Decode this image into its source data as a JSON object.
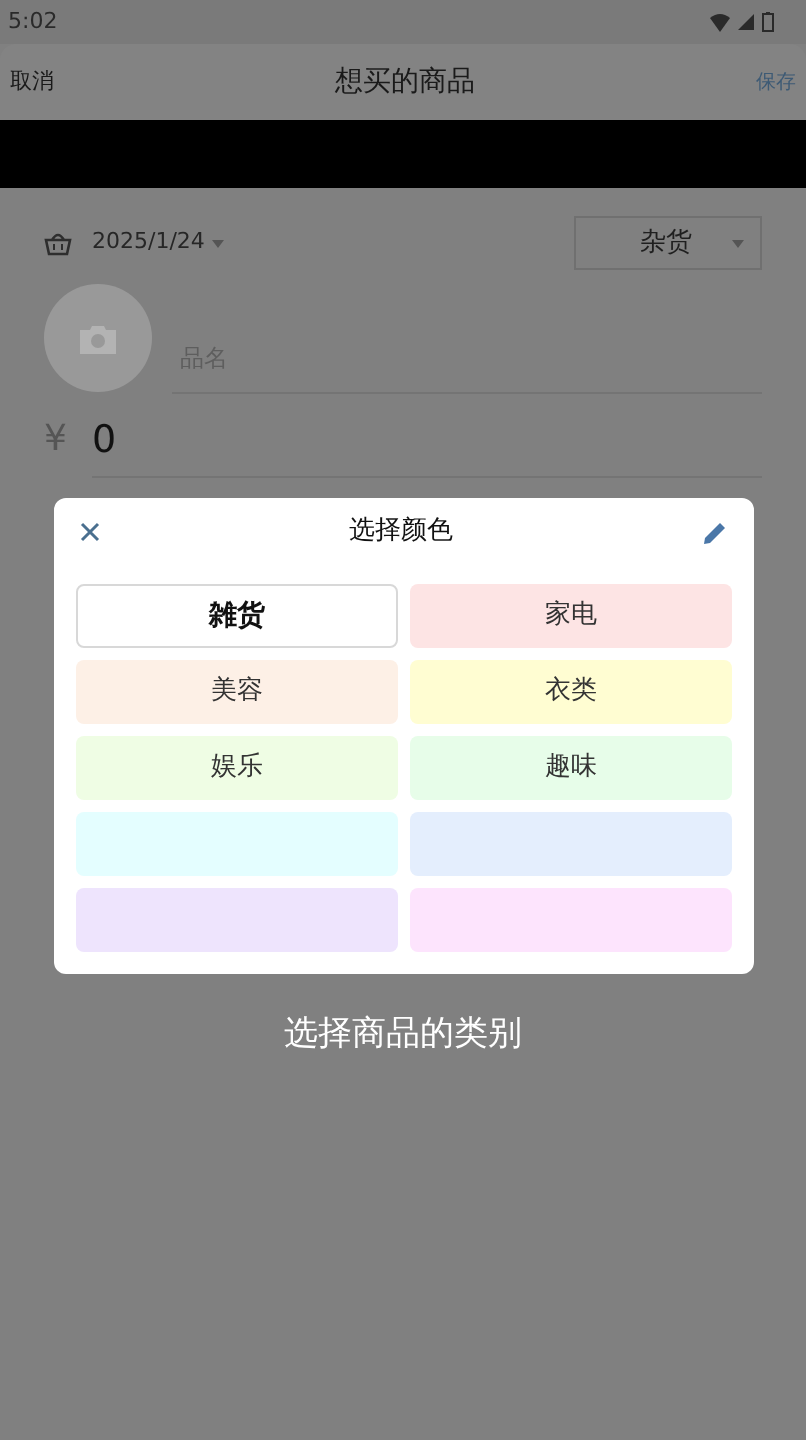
{
  "status_bar": {
    "time": "5:02"
  },
  "header": {
    "cancel": "取消",
    "title": "想买的商品",
    "save": "保存"
  },
  "form": {
    "date": "2025/1/24",
    "category": "杂货",
    "name_placeholder": "品名",
    "currency": "¥",
    "price": "0"
  },
  "dialog": {
    "title": "选择颜色",
    "swatches": [
      {
        "label": "雑货",
        "color": "#ffffff",
        "selected": true
      },
      {
        "label": "家电",
        "color": "#fde4e4",
        "selected": false
      },
      {
        "label": "美容",
        "color": "#fdf0e6",
        "selected": false
      },
      {
        "label": "衣类",
        "color": "#fffdd2",
        "selected": false
      },
      {
        "label": "娱乐",
        "color": "#effde4",
        "selected": false
      },
      {
        "label": "趣味",
        "color": "#e7fde9",
        "selected": false
      },
      {
        "color": "#e4feff",
        "selected": false
      },
      {
        "color": "#e4eefd",
        "selected": false
      },
      {
        "color": "#eee4fd",
        "selected": false
      },
      {
        "color": "#fde4fd",
        "selected": false
      }
    ]
  },
  "caption": "选择商品的类别"
}
